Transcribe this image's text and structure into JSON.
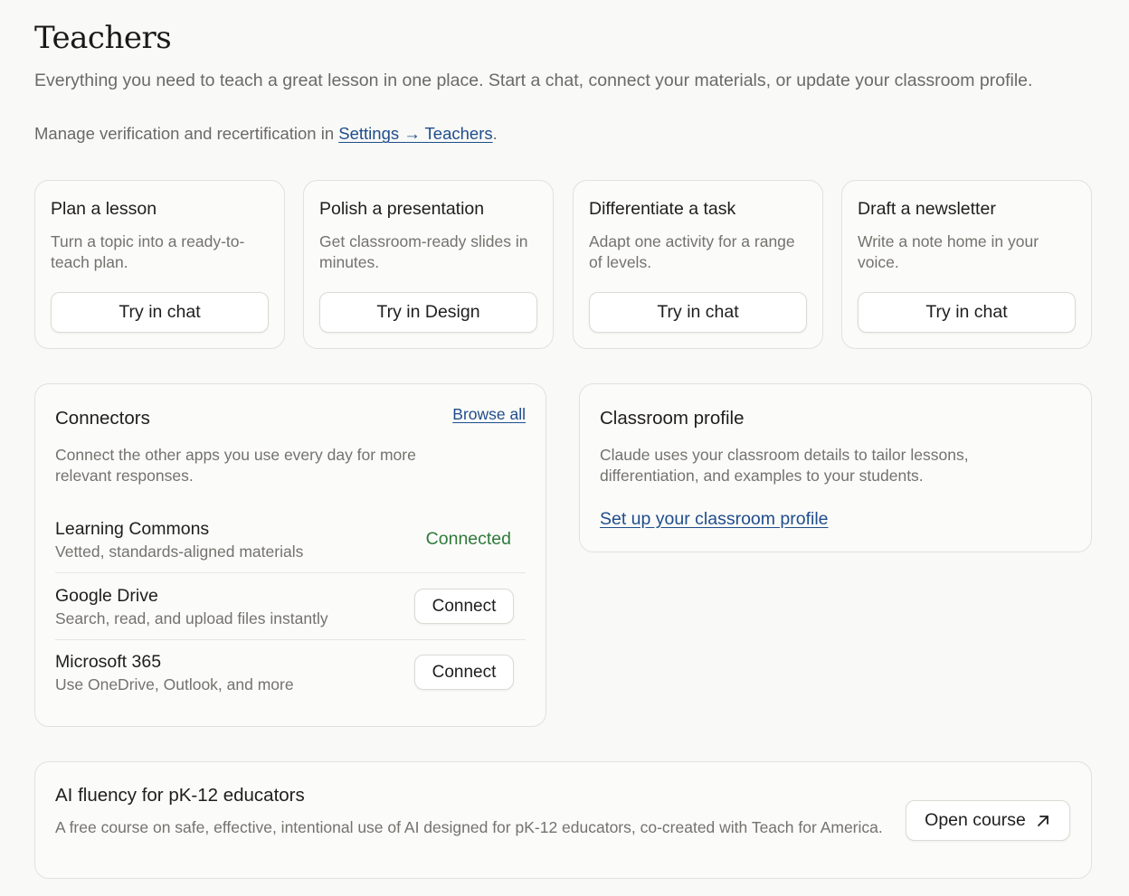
{
  "page": {
    "title": "Teachers",
    "subtitle": "Everything you need to teach a great lesson in one place. Start a chat, connect your materials, or update your classroom profile.",
    "manage_prefix": "Manage verification and recertification in ",
    "manage_link": "Settings → Teachers",
    "manage_suffix": "."
  },
  "actions": [
    {
      "title": "Plan a lesson",
      "desc": "Turn a topic into a ready-to-teach plan.",
      "button": "Try in chat"
    },
    {
      "title": "Polish a presentation",
      "desc": "Get classroom-ready slides in minutes.",
      "button": "Try in Design"
    },
    {
      "title": "Differentiate a task",
      "desc": "Adapt one activity for a range of levels.",
      "button": "Try in chat"
    },
    {
      "title": "Draft a newsletter",
      "desc": "Write a note home in your voice.",
      "button": "Try in chat"
    }
  ],
  "connectors": {
    "title": "Connectors",
    "browse_label": "Browse all",
    "desc": "Connect the other apps you use every day for more relevant responses.",
    "items": [
      {
        "name": "Learning Commons",
        "desc": "Vetted, standards-aligned materials",
        "status": "Connected"
      },
      {
        "name": "Google Drive",
        "desc": "Search, read, and upload files instantly",
        "button": "Connect"
      },
      {
        "name": "Microsoft 365",
        "desc": "Use OneDrive, Outlook, and more",
        "button": "Connect"
      }
    ]
  },
  "profile": {
    "title": "Classroom profile",
    "desc": "Claude uses your classroom details to tailor lessons, differentiation, and examples to your students.",
    "link": "Set up your classroom profile"
  },
  "course": {
    "title": "AI fluency for pK-12 educators",
    "desc": "A free course on safe, effective, intentional use of AI designed for pK-12 educators, co-created with Teach for America.",
    "button": "Open course",
    "button_icon": "external-arrow-icon"
  },
  "colors": {
    "background": "#f9f9f7",
    "link": "#1f4d8c",
    "connected": "#2f7a3a",
    "muted_text": "#74726d"
  }
}
